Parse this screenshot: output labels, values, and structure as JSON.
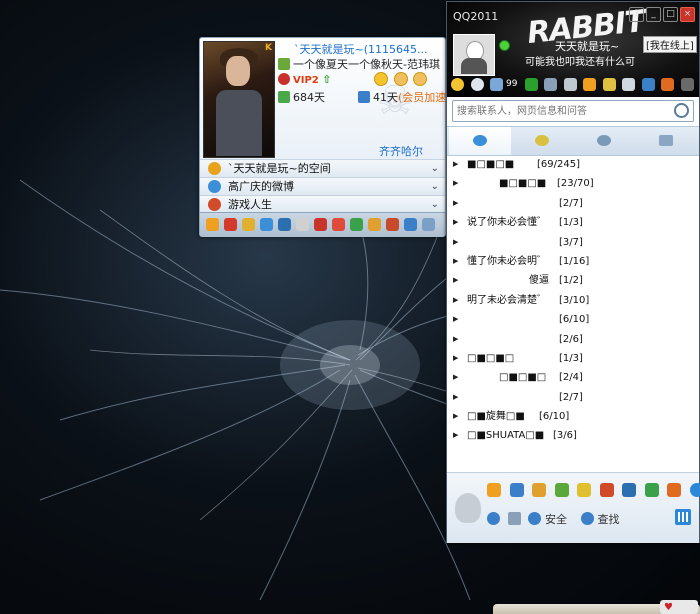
{
  "card": {
    "name": "`天天就是玩~(1115645...",
    "signature": "一个像夏天一个像秋天-范玮琪",
    "vip_label": "VIP2",
    "vip_arrow": "⇧",
    "active_days": "684天",
    "qq_days": "41天",
    "accel_label": "(会员加速中)",
    "city": "齐齐哈尔",
    "links": [
      {
        "label": "`天天就是玩~的空间",
        "icon_color": "#e9a21c"
      },
      {
        "label": "高广庆的微博",
        "icon_color": "#3b8ed8"
      },
      {
        "label": "游戏人生",
        "icon_color": "#d14a2a"
      }
    ]
  },
  "qq": {
    "title": "QQ2011",
    "header_logo": "RABBIT",
    "nickname": "天天就是玩~",
    "status": "[我在线上]",
    "signature": "可能我也叩我还有什么可",
    "mail_count": "99",
    "search_placeholder": "搜索联系人，网页信息和问答",
    "groups": [
      {
        "name": "■□■□■",
        "count": "[69/245]",
        "indent": 0
      },
      {
        "name": "■□■□■",
        "count": "[23/70]",
        "indent": 32
      },
      {
        "name": "",
        "count": "[2/7]",
        "indent": 92
      },
      {
        "name": "说了你未必会懂゛",
        "count": "[1/3]",
        "indent": 0
      },
      {
        "name": "",
        "count": "[3/7]",
        "indent": 92
      },
      {
        "name": "懂了你未必会明゛",
        "count": "[1/16]",
        "indent": 0
      },
      {
        "name": "傻逼",
        "count": "[1/2]",
        "indent": 62
      },
      {
        "name": "明了未必会清楚゛",
        "count": "[3/10]",
        "indent": 0
      },
      {
        "name": "",
        "count": "[6/10]",
        "indent": 92
      },
      {
        "name": "",
        "count": "[2/6]",
        "indent": 92
      },
      {
        "name": "□■□■□",
        "count": "[1/3]",
        "indent": 0
      },
      {
        "name": "□■□■□",
        "count": "[2/4]",
        "indent": 32
      },
      {
        "name": "",
        "count": "[2/7]",
        "indent": 92
      },
      {
        "name": "□■旋舞□■",
        "count": "[6/10]",
        "indent": 0
      },
      {
        "name": "□■SHUATA□■",
        "count": "[3/6]",
        "indent": 0
      }
    ],
    "bottom": {
      "security_label": "安全",
      "find_label": "查找"
    }
  },
  "taskbar": {
    "label": "♥"
  }
}
